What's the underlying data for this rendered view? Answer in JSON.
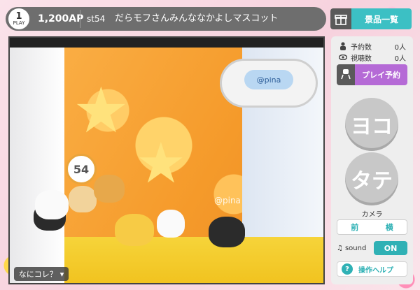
{
  "header": {
    "play_count": "1",
    "play_label": "PLAY",
    "ap": "1,200AP",
    "station": "st54",
    "machine_title": "だらモフさんみんななかよしマスコット"
  },
  "prize_list": {
    "label": "景品一覧",
    "icon": "gift-icon"
  },
  "video": {
    "badge_number": "54",
    "watermark": "@pina",
    "claw_logo": "@pina",
    "help_toggle_label": "なにコレ？"
  },
  "side": {
    "reservations": {
      "label": "予約数",
      "value": "0人",
      "icon": "person-icon"
    },
    "viewers": {
      "label": "視聴数",
      "value": "0人",
      "icon": "eye-icon"
    },
    "reserve_button": {
      "label": "プレイ予約",
      "icon": "claw-icon"
    },
    "horizontal_button": "ヨコ",
    "vertical_button": "タテ",
    "camera": {
      "label": "カメラ",
      "front": "前",
      "side": "横",
      "selected": "横"
    },
    "sound": {
      "label": "sound",
      "state": "ON",
      "icon": "music-note-icon"
    },
    "help": {
      "label": "操作ヘルプ",
      "icon": "question-icon"
    }
  },
  "colors": {
    "accent_teal": "#3cc0c4",
    "reserve_purple": "#b56ad6",
    "topbar_gray": "#6e6e6e"
  }
}
